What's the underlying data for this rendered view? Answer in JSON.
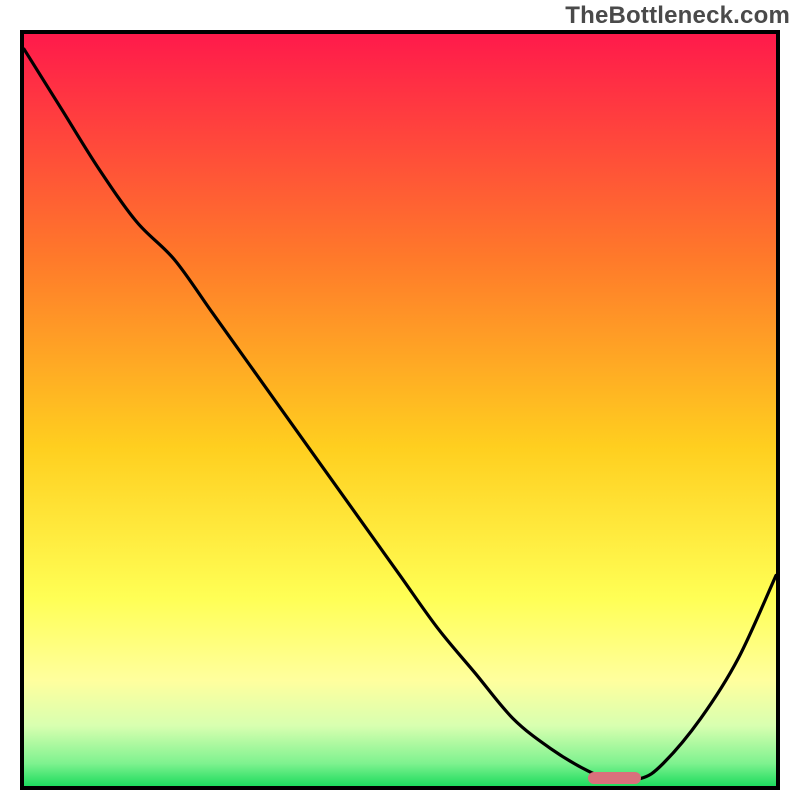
{
  "watermark": "TheBottleneck.com",
  "colors": {
    "top": "#ff1a4b",
    "mid_upper": "#ff9a1f",
    "mid": "#ffd21f",
    "mid_lower": "#ffff66",
    "pale_yellow": "#ffff9e",
    "light_green": "#b6f5a3",
    "green": "#2ee06a",
    "border": "#000000",
    "curve": "#000000",
    "marker": "#d9717c"
  },
  "chart_data": {
    "type": "line",
    "title": "",
    "xlabel": "",
    "ylabel": "",
    "xlim": [
      0,
      100
    ],
    "ylim": [
      0,
      100
    ],
    "x": [
      0,
      5,
      10,
      15,
      20,
      25,
      30,
      35,
      40,
      45,
      50,
      55,
      60,
      65,
      70,
      75,
      78,
      82,
      85,
      90,
      95,
      100
    ],
    "values": [
      98,
      90,
      82,
      75,
      70,
      63,
      56,
      49,
      42,
      35,
      28,
      21,
      15,
      9,
      5,
      2,
      1,
      1,
      3,
      9,
      17,
      28
    ],
    "marker_range": [
      75,
      82
    ],
    "marker_y": 1,
    "gradient_stops": [
      {
        "pos": 0.0,
        "color": "#ff1a4b"
      },
      {
        "pos": 0.3,
        "color": "#ff7a2a"
      },
      {
        "pos": 0.55,
        "color": "#ffcf1f"
      },
      {
        "pos": 0.75,
        "color": "#ffff55"
      },
      {
        "pos": 0.86,
        "color": "#ffff9e"
      },
      {
        "pos": 0.92,
        "color": "#d8ffb0"
      },
      {
        "pos": 0.97,
        "color": "#7ef28f"
      },
      {
        "pos": 1.0,
        "color": "#1edc5e"
      }
    ]
  }
}
